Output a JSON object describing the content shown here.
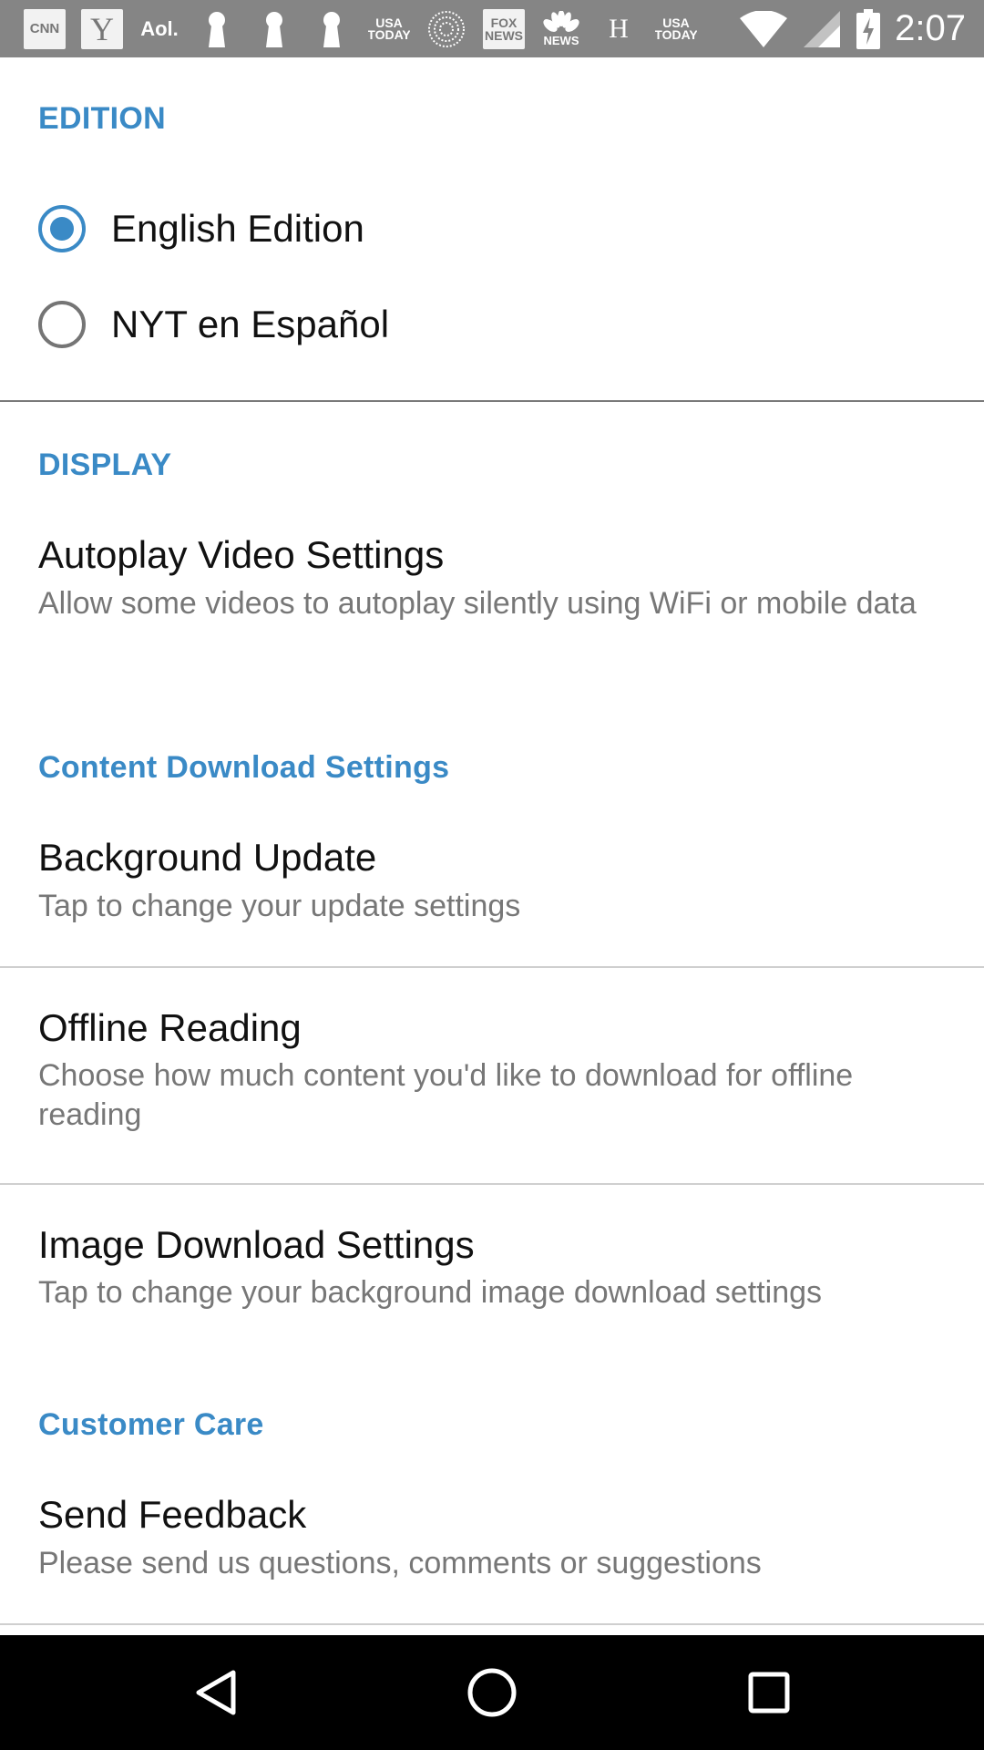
{
  "status_bar": {
    "notification_icons": [
      {
        "icon": "cnn-icon",
        "text": "CNN"
      },
      {
        "icon": "yahoo-icon",
        "text": "Y"
      },
      {
        "icon": "aol-icon",
        "text": "Aol."
      },
      {
        "icon": "keyhole-icon",
        "text": ""
      },
      {
        "icon": "keyhole-icon",
        "text": ""
      },
      {
        "icon": "keyhole-icon",
        "text": ""
      },
      {
        "icon": "usa-today-icon",
        "text": "USA TODAY"
      },
      {
        "icon": "dotted-globe-icon",
        "text": ""
      },
      {
        "icon": "fox-news-icon",
        "text": "FOX NEWS"
      },
      {
        "icon": "nbc-news-icon",
        "text": "NEWS"
      },
      {
        "icon": "huffpost-icon",
        "text": "H"
      },
      {
        "icon": "usa-today-icon",
        "text": "USA TODAY"
      }
    ],
    "wifi_icon": "wifi-icon",
    "signal_icon": "cell-signal-icon",
    "battery_icon": "battery-charging-icon",
    "time": "2:07"
  },
  "sections": {
    "edition": {
      "header": "EDITION",
      "options": [
        {
          "label": "English Edition",
          "selected": true
        },
        {
          "label": "NYT en Español",
          "selected": false
        }
      ]
    },
    "display": {
      "header": "DISPLAY",
      "autoplay": {
        "title": "Autoplay Video Settings",
        "summary": "Allow some videos to autoplay silently using WiFi or mobile data"
      }
    },
    "content_download": {
      "header": "Content Download Settings",
      "background_update": {
        "title": "Background Update",
        "summary": "Tap to change your update settings"
      },
      "offline_reading": {
        "title": "Offline Reading",
        "summary": "Choose how much content you'd like to download for offline reading"
      },
      "image_download": {
        "title": "Image Download Settings",
        "summary": "Tap to change your background image download settings"
      }
    },
    "customer_care": {
      "header": "Customer Care",
      "send_feedback": {
        "title": "Send Feedback",
        "summary": "Please send us questions, comments or suggestions"
      }
    }
  },
  "nav_bar": {
    "back_icon": "back-triangle-icon",
    "home_icon": "home-circle-icon",
    "recents_icon": "recents-square-icon"
  },
  "colors": {
    "accent": "#3a8ac6",
    "status_bar": "#858585",
    "nav_bar": "#000000",
    "title_text": "#111111",
    "summary_text": "#777777"
  }
}
